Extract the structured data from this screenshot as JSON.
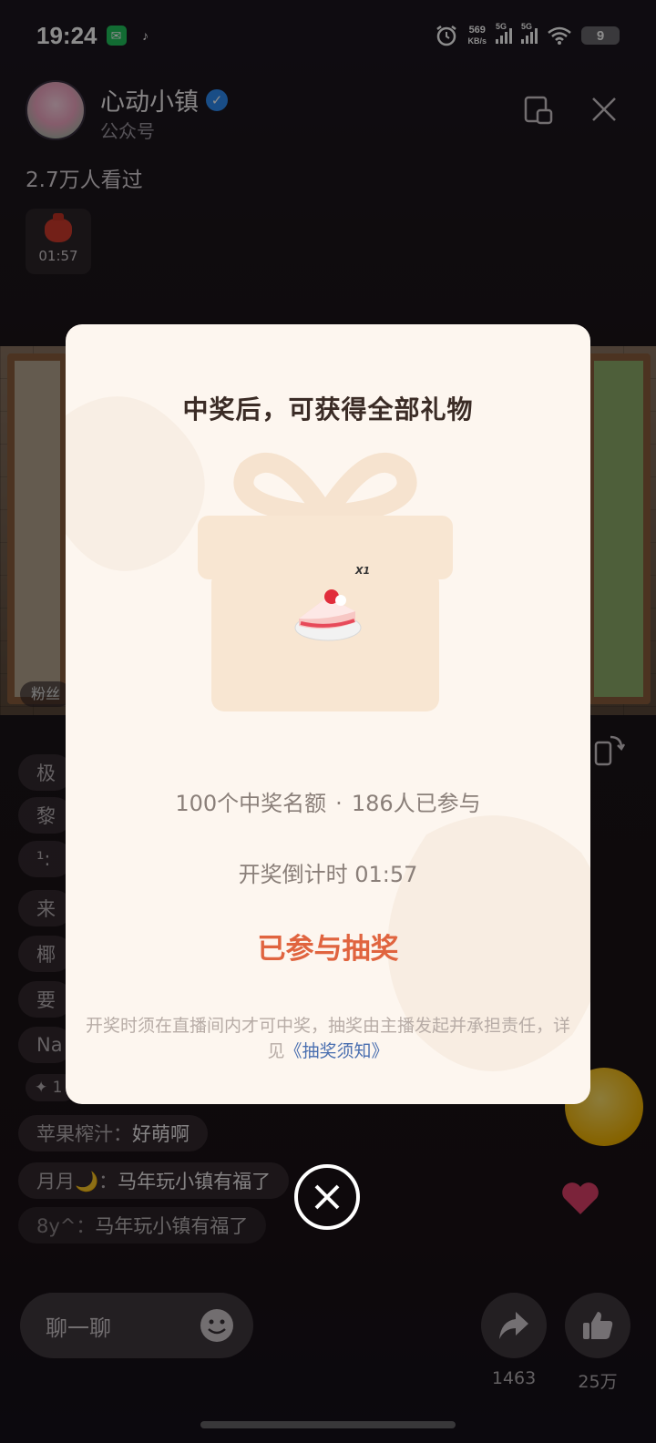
{
  "status_bar": {
    "time": "19:24",
    "net_speed_value": "569",
    "net_speed_unit": "KB/s",
    "signal1": "5G",
    "signal2": "5G",
    "battery": "9"
  },
  "header": {
    "host_name": "心动小镇",
    "host_sub": "公众号",
    "viewers": "2.7万人看过",
    "redbag_timer": "01:57"
  },
  "chat": {
    "items": [
      {
        "name": "极",
        "msg": ""
      },
      {
        "name": "黎",
        "msg": ""
      },
      {
        "name": "¹:",
        "msg": ""
      },
      {
        "name": "来",
        "msg": ""
      },
      {
        "name": "椰",
        "msg": ""
      },
      {
        "name": "要",
        "msg": ""
      },
      {
        "name": "Na",
        "msg": ""
      },
      {
        "name": "✦ 1",
        "msg": ""
      },
      {
        "name": "苹果榨汁：",
        "msg": "好萌啊"
      },
      {
        "name": "月月🌙：",
        "msg": "马年玩小镇有福了"
      },
      {
        "name": "8y^：",
        "msg": "马年玩小镇有福了"
      }
    ],
    "video_badge": "粉丝"
  },
  "bottom": {
    "chat_placeholder": "聊一聊",
    "share_count": "1463",
    "like_count": "25万"
  },
  "modal": {
    "title": "中奖后，可获得全部礼物",
    "gift_qty": "X1",
    "quota": "100个中奖名额",
    "participants": "186人已参与",
    "dot": "·",
    "countdown": "开奖倒计时 01:57",
    "joined_label": "已参与抽奖",
    "disclaimer": "开奖时须在直播间内才可中奖，抽奖由主播发起并承担责任，详见",
    "rules_link": "《抽奖须知》"
  },
  "colors": {
    "modal_bg": "#fdf6ef",
    "accent": "#e0643f",
    "link": "#4a6fb0"
  }
}
